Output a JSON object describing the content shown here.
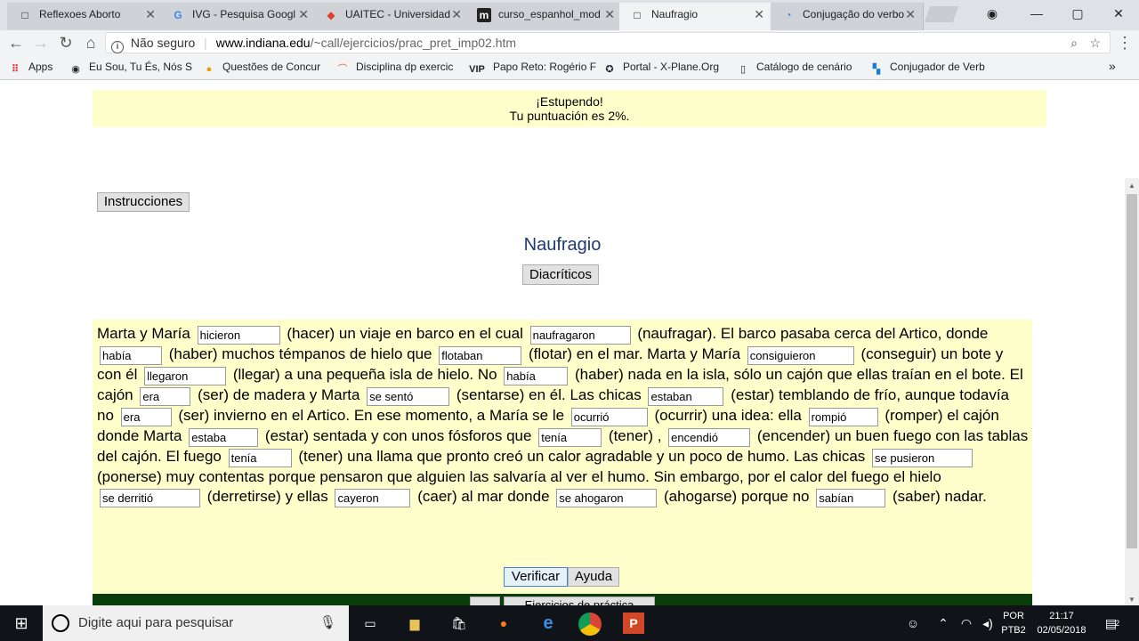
{
  "browser": {
    "tabs": [
      {
        "label": "Reflexoes Aborto",
        "icon": "document-icon"
      },
      {
        "label": "IVG - Pesquisa Googl",
        "icon": "google-icon"
      },
      {
        "label": "UAITEC - Universidad",
        "icon": "uaitec-icon"
      },
      {
        "label": "curso_espanhol_mod",
        "icon": "m-icon"
      },
      {
        "label": "Naufragio",
        "icon": "document-icon"
      },
      {
        "label": "Conjugação do verbo",
        "icon": "loading-icon"
      }
    ],
    "security": "Não seguro",
    "url_host": "www.indiana.edu",
    "url_path": "/~call/ejercicios/prac_pret_imp02.htm",
    "bookmarks": [
      {
        "label": "Apps"
      },
      {
        "label": "Eu Sou, Tu És, Nós S"
      },
      {
        "label": "Questões de Concur"
      },
      {
        "label": "Disciplina dp exercic"
      },
      {
        "label": "Papo Reto: Rogério F"
      },
      {
        "label": "Portal - X-Plane.Org"
      },
      {
        "label": "Catálogo de cenário"
      },
      {
        "label": "Conjugador de Verb"
      }
    ],
    "bookmark_vip": "VIP",
    "more": "»"
  },
  "page": {
    "banner_line1": "¡Estupendo!",
    "banner_line2": "Tu puntuación es 2%.",
    "instructions_button": "Instrucciones",
    "title": "Naufragio",
    "diacritics_button": "Diacríticos",
    "verify_button": "Verificar",
    "help_button": "Ayuda",
    "footer_partial_button": "Ejercicios de práctica"
  },
  "exercise": {
    "t0": "Marta y María ",
    "a1": "hicieron",
    "t1": " (hacer) un viaje en barco en el cual ",
    "a2": "naufragaron",
    "t2": " (naufragar). El barco pasaba cerca del Artico, donde ",
    "a3": "había",
    "t3": " (haber) muchos témpanos de hielo que ",
    "a4": "flotaban",
    "t4": " (flotar) en el mar. Marta y María ",
    "a5": "consiguieron",
    "t5": " (conseguir) un bote y con él ",
    "a6": "llegaron",
    "t6": " (llegar) a una pequeña isla de hielo. No ",
    "a7": "había",
    "t7": " (haber) nada en la isla, sólo un cajón que ellas traían en el bote. El cajón ",
    "a8": "era",
    "t8": " (ser) de madera y Marta ",
    "a9": "se sentó",
    "t9": " (sentarse) en él. Las chicas ",
    "a10": "estaban",
    "t10": " (estar) temblando de frío, aunque todavía no ",
    "a11": "era",
    "t11": " (ser) invierno en el Artico. En ese momento, a María se le ",
    "a12": "ocurrió",
    "t12": " (ocurrir) una idea: ella ",
    "a13": "rompió",
    "t13": " (romper) el cajón donde Marta ",
    "a14": "estaba",
    "t14": " (estar) sentada y con unos fósforos que ",
    "a15": "tenía",
    "t15": " (tener) , ",
    "a16": "encendió",
    "t16": " (encender) un buen fuego con las tablas del cajón. El fuego ",
    "a17": "tenía",
    "t17": " (tener) una llama que pronto creó un calor agradable y un poco de humo. Las chicas ",
    "a18": "se pusieron",
    "t18": " (ponerse) muy contentas porque pensaron que alguien las salvaría al ver el humo. Sin embargo, por el calor del fuego el hielo ",
    "a19": "se derritió",
    "t19": " (derretirse) y ellas ",
    "a20": "cayeron",
    "t20": " (caer) al mar donde ",
    "a21": "se ahogaron",
    "t21": " (ahogarse) porque no ",
    "a22": "sabían",
    "t22": " (saber) nadar."
  },
  "taskbar": {
    "search_placeholder": "Digite aqui para pesquisar",
    "lang1": "POR",
    "lang2": "PTB2",
    "time": "21:17",
    "date": "02/05/2018",
    "notifications": "2"
  }
}
